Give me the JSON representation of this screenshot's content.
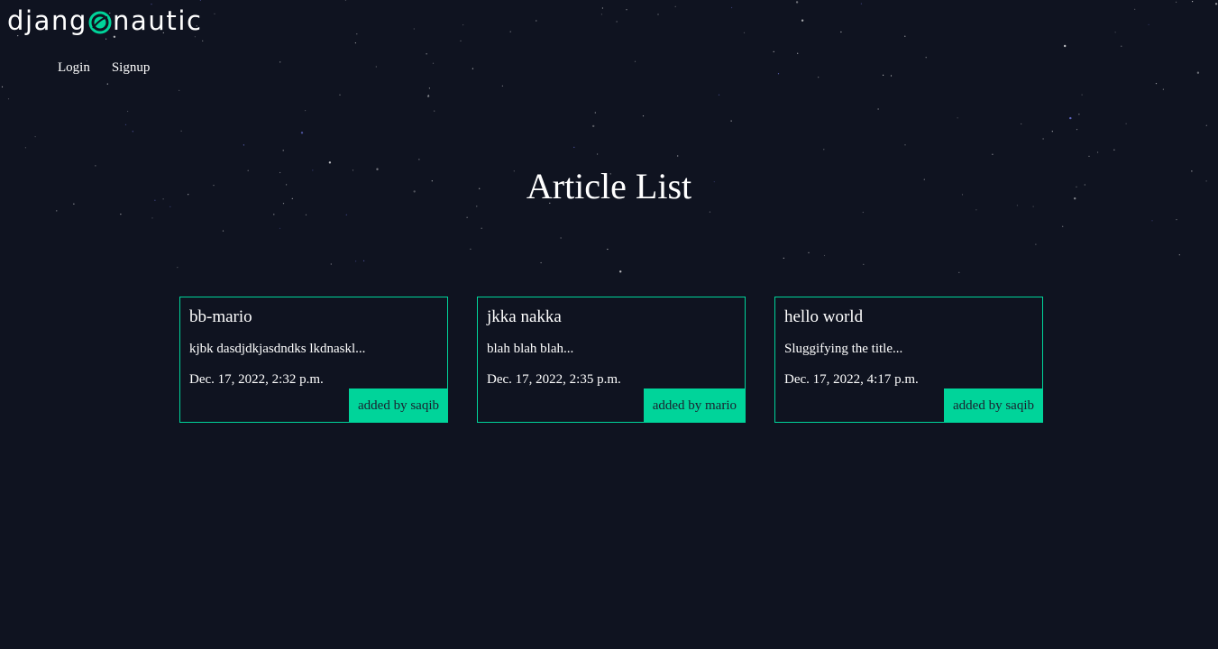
{
  "brand": {
    "prefix": "djang",
    "suffix": "nautic",
    "icon": "orbit-o-icon",
    "accent": "#00d49a"
  },
  "nav": {
    "login": "Login",
    "signup": "Signup"
  },
  "page": {
    "title": "Article List",
    "background": "#0f1320"
  },
  "articles": [
    {
      "title": "bb-mario",
      "snippet": "kjbk dasdjdkjasdndks lkdnaskl...",
      "date": "Dec. 17, 2022, 2:32 p.m.",
      "author": "added by saqib"
    },
    {
      "title": "jkka nakka",
      "snippet": "blah blah blah...",
      "date": "Dec. 17, 2022, 2:35 p.m.",
      "author": "added by mario"
    },
    {
      "title": "hello world",
      "snippet": "Sluggifying the title...",
      "date": "Dec. 17, 2022, 4:17 p.m.",
      "author": "added by saqib"
    }
  ]
}
